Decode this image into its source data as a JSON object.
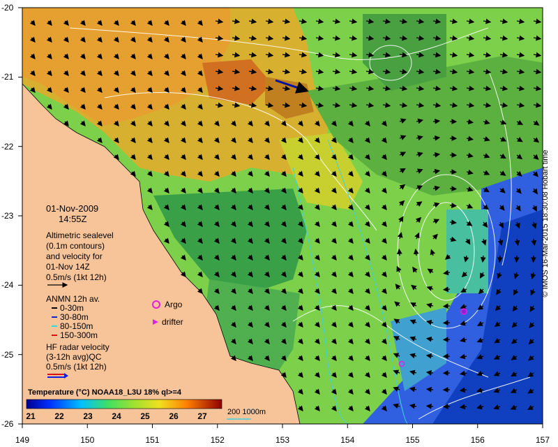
{
  "map": {
    "date": "01-Nov-2009",
    "time": "14:55Z",
    "altimetry_lines": [
      "Altimetric sealevel",
      "(0.1m contours)",
      "and velocity for",
      "01-Nov 14Z",
      "0.5m/s (1kt 12h)"
    ],
    "anmn_title": "ANMN 12h av.",
    "anmn_items": [
      {
        "label": "0-30m",
        "color": "#000000"
      },
      {
        "label": "30-80m",
        "color": "#1020e0"
      },
      {
        "label": "80-150m",
        "color": "#20e0e0"
      },
      {
        "label": "150-300m",
        "color": "#e01010"
      }
    ],
    "argo_label": "Argo",
    "drifter_label": "drifter",
    "hf_lines": [
      "HF radar velocity",
      "(3-12h avg)QC",
      "0.5m/s (1kt 12h)"
    ],
    "colorbar_title": "Temperature (°C) NOAA18_L3U 18% ql>=4",
    "colorbar_ticks": [
      "21",
      "22",
      "23",
      "24",
      "25",
      "26",
      "27"
    ],
    "depth_legend": "200  1000m",
    "credit": "© IMOS 16-Mar-2015 18:30:08 Hobart time",
    "lon_ticks": [
      "149",
      "150",
      "151",
      "152",
      "153",
      "154",
      "155",
      "156",
      "157"
    ],
    "lat_ticks": [
      "-20",
      "-21",
      "-22",
      "-23",
      "-24",
      "-25",
      "-26"
    ],
    "colors": {
      "land": "#f7c49a",
      "arrow": "#000000",
      "contour": "#ffffff",
      "bathy": "#40d0e0",
      "argo": "#e020e0"
    }
  }
}
